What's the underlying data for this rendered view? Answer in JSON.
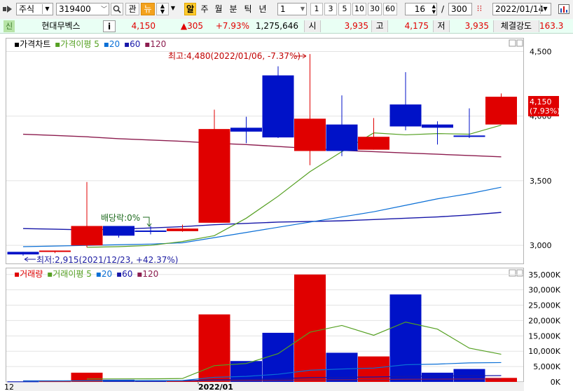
{
  "toolbar": {
    "market": "주식",
    "code": "319400",
    "btn_gwan": "관",
    "btn_nyu": "뉴",
    "btn_al": "알",
    "periods": [
      "주",
      "월",
      "분",
      "틱",
      "년"
    ],
    "interval_value": "1",
    "quick_nums": [
      "1",
      "3",
      "5",
      "10",
      "30",
      "60"
    ],
    "count_value": "16",
    "slash": "/",
    "total_value": "300",
    "date_value": "2022/01/14"
  },
  "infobar": {
    "shin": "신",
    "name": "현대무벡스",
    "info_btn": "i",
    "price": "4,150",
    "change": "▲305",
    "change_pct": "+7.93%",
    "volume": "1,275,646",
    "open_label": "시",
    "open": "3,935",
    "high_label": "고",
    "high": "4,175",
    "low_label": "저",
    "low": "3,935",
    "strength_label": "체결강도",
    "strength": "163.3"
  },
  "colors": {
    "up": "#e00000",
    "down": "#0012c8",
    "ma5": "#55a022",
    "ma20": "#0a6fd6",
    "ma60": "#1616a8",
    "ma120": "#8c1c4e"
  },
  "chart_data": [
    {
      "type": "candlestick",
      "legend": [
        "가격차트",
        "가격이평 5",
        "20",
        "60",
        "120"
      ],
      "ylim": [
        2860,
        4600
      ],
      "y_ticks": [
        3000,
        3500,
        4000,
        4500
      ],
      "y_tick_labels": [
        "3,000",
        "3,500",
        "4,000",
        "4,500"
      ],
      "candles": [
        {
          "o": 2950,
          "h": 2950,
          "l": 2920,
          "c": 2930
        },
        {
          "o": 2950,
          "h": 2960,
          "l": 2940,
          "c": 2960
        },
        {
          "o": 3000,
          "h": 3490,
          "l": 2985,
          "c": 3150
        },
        {
          "o": 3150,
          "h": 3150,
          "l": 3060,
          "c": 3075
        },
        {
          "o": 3115,
          "h": 3150,
          "l": 3085,
          "c": 3105
        },
        {
          "o": 3110,
          "h": 3160,
          "l": 3105,
          "c": 3130
        },
        {
          "o": 3175,
          "h": 4050,
          "l": 3175,
          "c": 3900
        },
        {
          "o": 3910,
          "h": 3995,
          "l": 3790,
          "c": 3880
        },
        {
          "o": 4315,
          "h": 4385,
          "l": 3830,
          "c": 3835
        },
        {
          "o": 3730,
          "h": 4480,
          "l": 3620,
          "c": 3980
        },
        {
          "o": 3935,
          "h": 4160,
          "l": 3690,
          "c": 3730
        },
        {
          "o": 3740,
          "h": 3985,
          "l": 3740,
          "c": 3840
        },
        {
          "o": 4090,
          "h": 4340,
          "l": 3890,
          "c": 3920
        },
        {
          "o": 3935,
          "h": 3960,
          "l": 3780,
          "c": 3910
        },
        {
          "o": 3850,
          "h": 4060,
          "l": 3830,
          "c": 3840
        },
        {
          "o": 3935,
          "h": 4175,
          "l": 3935,
          "c": 4150
        }
      ],
      "ma5": [
        null,
        null,
        2985,
        2990,
        3000,
        3030,
        3075,
        3210,
        3380,
        3570,
        3725,
        3870,
        3855,
        3865,
        3860,
        3930
      ],
      "ma20": [
        2990,
        2995,
        3000,
        3005,
        3010,
        3020,
        3060,
        3100,
        3140,
        3180,
        3220,
        3260,
        3310,
        3360,
        3400,
        3450
      ],
      "ma60": [
        3130,
        3125,
        3120,
        3125,
        3135,
        3145,
        3160,
        3170,
        3180,
        3185,
        3190,
        3200,
        3210,
        3220,
        3235,
        3255
      ],
      "ma120": [
        3860,
        3850,
        3840,
        3825,
        3815,
        3805,
        3790,
        3780,
        3765,
        3750,
        3735,
        3725,
        3715,
        3705,
        3695,
        3685
      ],
      "annotations": {
        "high": "최고:4,480(2022/01/06, -7.37%)",
        "low": "최저:2,915(2021/12/23, +42.37%)",
        "dividend": "배당락:0%",
        "price_box_value": "4,150",
        "price_box_pct": "(7.93%)"
      }
    },
    {
      "type": "bar",
      "legend": [
        "거래량",
        "거래이평 5",
        "20",
        "60",
        "120"
      ],
      "ylim": [
        0,
        37000
      ],
      "y_ticks": [
        0,
        5000,
        10000,
        15000,
        20000,
        25000,
        30000,
        35000
      ],
      "y_tick_labels": [
        "0K",
        "5,000K",
        "10,000K",
        "15,000K",
        "20,000K",
        "25,000K",
        "30,000K",
        "35,000K"
      ],
      "values": [
        150,
        200,
        3000,
        700,
        450,
        500,
        22000,
        6800,
        16000,
        35000,
        9500,
        8300,
        28500,
        3000,
        4200,
        1300
      ],
      "ma5": [
        null,
        null,
        950,
        980,
        1000,
        1100,
        5300,
        6000,
        9200,
        16200,
        18400,
        15200,
        19500,
        17200,
        11000,
        9000
      ],
      "ma20": [
        300,
        300,
        400,
        400,
        420,
        450,
        1500,
        1800,
        2500,
        3800,
        4200,
        4500,
        5600,
        5800,
        6200,
        6300
      ],
      "ma60": [
        350,
        350,
        360,
        360,
        370,
        380,
        700,
        800,
        1000,
        1400,
        1500,
        1600,
        1800,
        1900,
        2000,
        2050
      ],
      "ma120": [
        300,
        300,
        300,
        300,
        300,
        310,
        400,
        450,
        500,
        650,
        700,
        750,
        850,
        900,
        950,
        980
      ],
      "x_labels": [
        "12",
        "2022/01"
      ]
    }
  ]
}
